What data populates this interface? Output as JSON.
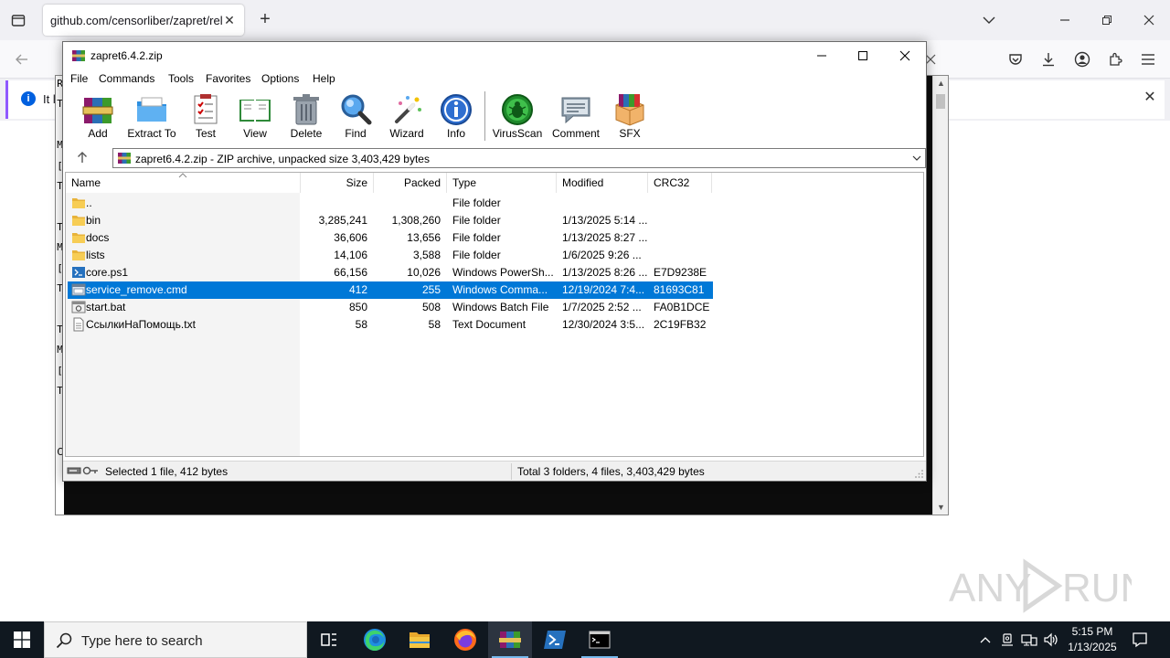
{
  "browser": {
    "tab_title": "github.com/censorliber/zapret/rele",
    "notice_text": "It l"
  },
  "console": {
    "left_chars": [
      "R",
      "T",
      "",
      "M",
      "[",
      "T",
      "",
      "T",
      "M",
      "[",
      "T",
      "",
      "T",
      "M",
      "[",
      "T",
      "",
      "",
      "C"
    ]
  },
  "winrar": {
    "title": "zapret6.4.2.zip",
    "menu": [
      "File",
      "Commands",
      "Tools",
      "Favorites",
      "Options",
      "Help"
    ],
    "tools": [
      {
        "label": "Add",
        "icon": "add-archive-icon"
      },
      {
        "label": "Extract To",
        "icon": "extract-folder-icon"
      },
      {
        "label": "Test",
        "icon": "test-clipboard-icon"
      },
      {
        "label": "View",
        "icon": "view-book-icon"
      },
      {
        "label": "Delete",
        "icon": "trash-can-icon"
      },
      {
        "label": "Find",
        "icon": "magnifier-icon"
      },
      {
        "label": "Wizard",
        "icon": "magic-wand-icon"
      },
      {
        "label": "Info",
        "icon": "info-icon"
      },
      {
        "label": "VirusScan",
        "icon": "virus-bug-icon"
      },
      {
        "label": "Comment",
        "icon": "comment-icon"
      },
      {
        "label": "SFX",
        "icon": "sfx-box-icon"
      }
    ],
    "address": "zapret6.4.2.zip - ZIP archive, unpacked size 3,403,429 bytes",
    "columns": [
      "Name",
      "Size",
      "Packed",
      "Type",
      "Modified",
      "CRC32"
    ],
    "rows": [
      {
        "name": "..",
        "size": "",
        "packed": "",
        "type": "File folder",
        "modified": "",
        "crc": "",
        "icon": "folder-icon",
        "selected": false
      },
      {
        "name": "bin",
        "size": "3,285,241",
        "packed": "1,308,260",
        "type": "File folder",
        "modified": "1/13/2025 5:14 ...",
        "crc": "",
        "icon": "folder-icon",
        "selected": false
      },
      {
        "name": "docs",
        "size": "36,606",
        "packed": "13,656",
        "type": "File folder",
        "modified": "1/13/2025 8:27 ...",
        "crc": "",
        "icon": "folder-icon",
        "selected": false
      },
      {
        "name": "lists",
        "size": "14,106",
        "packed": "3,588",
        "type": "File folder",
        "modified": "1/6/2025 9:26 ...",
        "crc": "",
        "icon": "folder-icon",
        "selected": false
      },
      {
        "name": "core.ps1",
        "size": "66,156",
        "packed": "10,026",
        "type": "Windows PowerSh...",
        "modified": "1/13/2025 8:26 ...",
        "crc": "E7D9238E",
        "icon": "powershell-file-icon",
        "selected": false
      },
      {
        "name": "service_remove.cmd",
        "size": "412",
        "packed": "255",
        "type": "Windows Comma...",
        "modified": "12/19/2024 7:4...",
        "crc": "81693C81",
        "icon": "cmd-file-icon",
        "selected": true
      },
      {
        "name": "start.bat",
        "size": "850",
        "packed": "508",
        "type": "Windows Batch File",
        "modified": "1/7/2025 2:52 ...",
        "crc": "FA0B1DCE",
        "icon": "batch-file-icon",
        "selected": false
      },
      {
        "name": "СсылкиНаПомощь.txt",
        "size": "58",
        "packed": "58",
        "type": "Text Document",
        "modified": "12/30/2024 3:5...",
        "crc": "2C19FB32",
        "icon": "text-file-icon",
        "selected": false
      }
    ],
    "status_left": "Selected 1 file, 412 bytes",
    "status_right": "Total 3 folders, 4 files, 3,403,429 bytes"
  },
  "watermark": {
    "text": "ANY RUN"
  },
  "taskbar": {
    "search_placeholder": "Type here to search",
    "apps": [
      {
        "icon": "task-view-icon",
        "active": false
      },
      {
        "icon": "edge-browser-icon",
        "active": false
      },
      {
        "icon": "file-explorer-icon",
        "active": false
      },
      {
        "icon": "firefox-icon",
        "active": false
      },
      {
        "icon": "winrar-icon",
        "active": true
      },
      {
        "icon": "powershell-icon",
        "active": false
      },
      {
        "icon": "command-prompt-icon",
        "active": false
      }
    ],
    "time": "5:15 PM",
    "date": "1/13/2025"
  },
  "colors": {
    "selection": "#0078d7",
    "taskbar": "#101820",
    "browser_chrome": "#f0f0f4"
  }
}
